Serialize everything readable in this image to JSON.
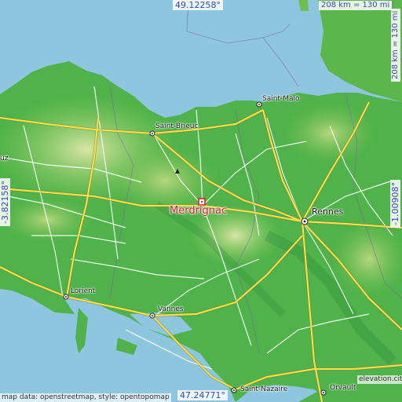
{
  "coordinates": {
    "north": "49.12258°",
    "south": "47.24771°",
    "west": "-3.82158°",
    "east": "-1.00908°"
  },
  "scale": {
    "horizontal": "208 km = 130 mi",
    "vertical": "208 km = 130 mi"
  },
  "target": {
    "name": "Merdrignac"
  },
  "places": [
    {
      "name": "Saint-Malo"
    },
    {
      "name": "Saint-Brieuc"
    },
    {
      "name": "Rennes"
    },
    {
      "name": "Lorient"
    },
    {
      "name": "Vannes"
    },
    {
      "name": "Saint-Nazaire"
    },
    {
      "name": "Orvault"
    },
    {
      "name": "uz"
    }
  ],
  "attribution": {
    "left": "map data: openstreetmap, style: opentopomap",
    "right": "elevation.city"
  },
  "colors": {
    "sea": "#8fc6df",
    "land_low": "#4fb24a",
    "land_mid": "#8bcb5c",
    "land_high": "#c9dd8c",
    "road_major": "#f4e04d",
    "road_minor": "#ffffff",
    "target": "#d2232a",
    "coord_text": "#3a47b8"
  }
}
